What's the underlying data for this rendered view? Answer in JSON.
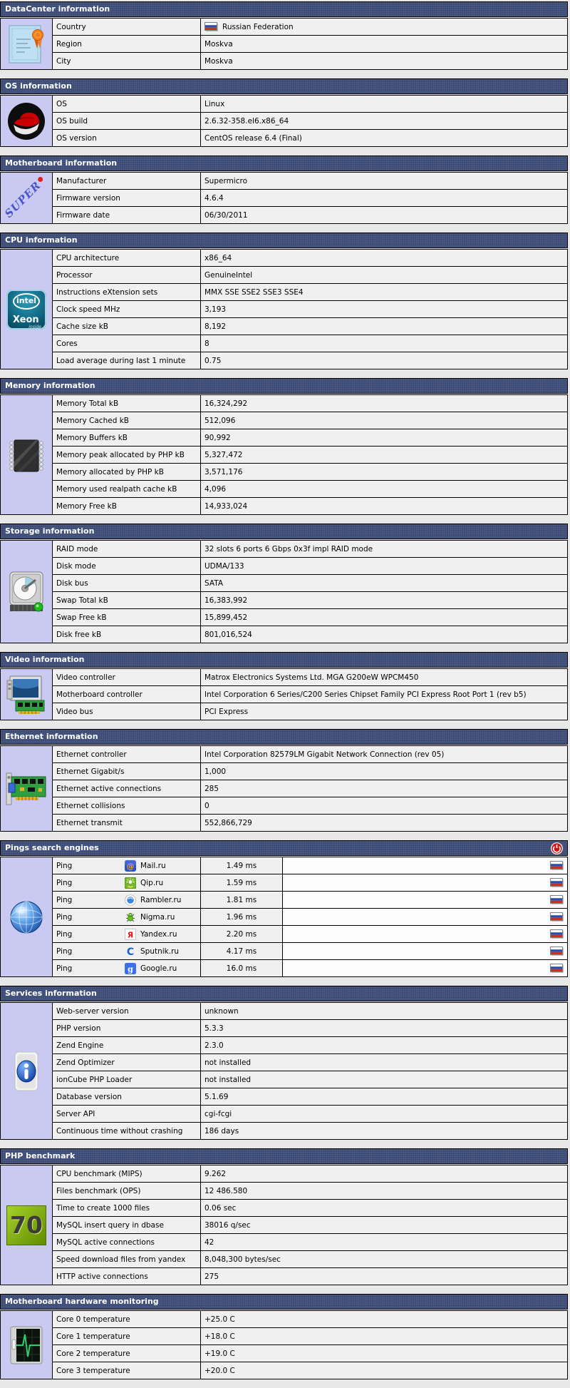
{
  "colors": {
    "header_bg": "#2d4b78",
    "header_text": "#ffffff",
    "icon_cell_bg": "#c9c9f1",
    "row_bg": "#f0f0f0",
    "page_bg": "#e8e8e8",
    "border": "#000000",
    "flag_white": "#ffffff",
    "flag_blue": "#2a4fa8",
    "flag_red": "#d52b1e"
  },
  "sections": [
    {
      "title": "DataCenter information",
      "icon": "certificate-icon",
      "type": "info",
      "rows": [
        {
          "label": "Country",
          "value": "Russian Federation",
          "value_flag": "russia-flag"
        },
        {
          "label": "Region",
          "value": "Moskva"
        },
        {
          "label": "City",
          "value": "Moskva"
        }
      ]
    },
    {
      "title": "OS information",
      "icon": "redhat-icon",
      "type": "info",
      "rows": [
        {
          "label": "OS",
          "value": "Linux"
        },
        {
          "label": "OS build",
          "value": "2.6.32-358.el6.x86_64"
        },
        {
          "label": "OS version",
          "value": "CentOS release 6.4 (Final)"
        }
      ]
    },
    {
      "title": "Motherboard information",
      "icon": "supermicro-icon",
      "type": "info",
      "rows": [
        {
          "label": "Manufacturer",
          "value": "Supermicro"
        },
        {
          "label": "Firmware version",
          "value": "4.6.4"
        },
        {
          "label": "Firmware date",
          "value": "06/30/2011"
        }
      ]
    },
    {
      "title": "CPU information",
      "icon": "intel-xeon-icon",
      "type": "info",
      "rows": [
        {
          "label": "CPU architecture",
          "value": "x86_64"
        },
        {
          "label": "Processor",
          "value": "GenuineIntel"
        },
        {
          "label": "Instructions eXtension sets",
          "value": "MMX SSE SSE2 SSE3 SSE4"
        },
        {
          "label": "Clock speed MHz",
          "value": "3,193"
        },
        {
          "label": "Cache size kB",
          "value": "8,192"
        },
        {
          "label": "Cores",
          "value": "8"
        },
        {
          "label": "Load average during last 1 minute",
          "value": "0.75"
        }
      ]
    },
    {
      "title": "Memory information",
      "icon": "ram-chip-icon",
      "type": "info",
      "rows": [
        {
          "label": "Memory Total kB",
          "value": "16,324,292"
        },
        {
          "label": "Memory Cached kB",
          "value": "512,096"
        },
        {
          "label": "Memory Buffers kB",
          "value": "90,992"
        },
        {
          "label": "Memory peak allocated by PHP kB",
          "value": "5,327,472"
        },
        {
          "label": "Memory allocated by PHP kB",
          "value": "3,571,176"
        },
        {
          "label": "Memory used realpath cache kB",
          "value": "4,096"
        },
        {
          "label": "Memory Free kB",
          "value": "14,933,024"
        }
      ]
    },
    {
      "title": "Storage information",
      "icon": "hdd-icon",
      "type": "info",
      "rows": [
        {
          "label": "RAID mode",
          "value": "32 slots 6 ports 6 Gbps 0x3f impl RAID mode"
        },
        {
          "label": "Disk mode",
          "value": "UDMA/133"
        },
        {
          "label": "Disk bus",
          "value": "SATA"
        },
        {
          "label": "Swap Total kB",
          "value": "16,383,992"
        },
        {
          "label": "Swap Free kB",
          "value": "15,899,452"
        },
        {
          "label": "Disk free kB",
          "value": "801,016,524"
        }
      ]
    },
    {
      "title": "Video information",
      "icon": "video-card-icon",
      "type": "info",
      "rows": [
        {
          "label": "Video controller",
          "value": "Matrox Electronics Systems Ltd. MGA G200eW WPCM450"
        },
        {
          "label": "Motherboard controller",
          "value": "Intel Corporation 6 Series/C200 Series Chipset Family PCI Express Root Port 1 (rev b5)"
        },
        {
          "label": "Video bus",
          "value": "PCI Express"
        }
      ]
    },
    {
      "title": "Ethernet information",
      "icon": "ethernet-card-icon",
      "type": "info",
      "rows": [
        {
          "label": "Ethernet controller",
          "value": "Intel Corporation 82579LM Gigabit Network Connection (rev 05)"
        },
        {
          "label": "Ethernet Gigabit/s",
          "value": "1,000"
        },
        {
          "label": "Ethernet active connections",
          "value": "285"
        },
        {
          "label": "Ethernet collisions",
          "value": "0"
        },
        {
          "label": "Ethernet transmit",
          "value": "552,866,729"
        }
      ]
    },
    {
      "title": "Pings search engines",
      "icon": "globe-icon",
      "header_icon": "power-icon",
      "type": "pings",
      "rows": [
        {
          "label": "Ping",
          "site": "Mail.ru",
          "site_icon": "mailru-icon",
          "value": "1.49 ms",
          "flag": "russia-flag"
        },
        {
          "label": "Ping",
          "site": "Qip.ru",
          "site_icon": "qip-icon",
          "value": "1.59 ms",
          "flag": "russia-flag"
        },
        {
          "label": "Ping",
          "site": "Rambler.ru",
          "site_icon": "rambler-icon",
          "value": "1.81 ms",
          "flag": "russia-flag"
        },
        {
          "label": "Ping",
          "site": "Nigma.ru",
          "site_icon": "nigma-icon",
          "value": "1.96 ms",
          "flag": "russia-flag"
        },
        {
          "label": "Ping",
          "site": "Yandex.ru",
          "site_icon": "yandex-icon",
          "value": "2.20 ms",
          "flag": "russia-flag"
        },
        {
          "label": "Ping",
          "site": "Sputnik.ru",
          "site_icon": "sputnik-icon",
          "value": "4.17 ms",
          "flag": "russia-flag"
        },
        {
          "label": "Ping",
          "site": "Google.ru",
          "site_icon": "google-icon",
          "value": "16.0 ms",
          "flag": "russia-flag"
        }
      ]
    },
    {
      "title": "Services information",
      "icon": "info-icon",
      "type": "info",
      "rows": [
        {
          "label": "Web-server version",
          "value": "unknown"
        },
        {
          "label": "PHP version",
          "value": "5.3.3"
        },
        {
          "label": "Zend Engine",
          "value": "2.3.0"
        },
        {
          "label": "Zend Optimizer",
          "value": "not installed"
        },
        {
          "label": "ionCube PHP Loader",
          "value": "not installed"
        },
        {
          "label": "Database version",
          "value": "5.1.69"
        },
        {
          "label": "Server API",
          "value": "cgi-fcgi"
        },
        {
          "label": "Continuous time without crashing",
          "value": "186 days"
        }
      ]
    },
    {
      "title": "PHP benchmark",
      "icon": "benchmark-70-icon",
      "type": "info",
      "rows": [
        {
          "label": "CPU benchmark (MIPS)",
          "value": "9.262"
        },
        {
          "label": "Files benchmark (OPS)",
          "value": "12 486.580"
        },
        {
          "label": "Time to create 1000 files",
          "value": "0.06 sec"
        },
        {
          "label": "MySQL insert query in dbase",
          "value": "38016 q/sec"
        },
        {
          "label": "MySQL active connections",
          "value": "42"
        },
        {
          "label": "Speed download files from yandex",
          "value": "8,048,300 bytes/sec"
        },
        {
          "label": "HTTP active connections",
          "value": "275"
        }
      ]
    },
    {
      "title": "Motherboard hardware monitoring",
      "icon": "monitoring-icon",
      "type": "info",
      "rows": [
        {
          "label": "Core 0 temperature",
          "value": "+25.0 C"
        },
        {
          "label": "Core 1 temperature",
          "value": "+18.0 C"
        },
        {
          "label": "Core 2 temperature",
          "value": "+19.0 C"
        },
        {
          "label": "Core 3 temperature",
          "value": "+20.0 C"
        }
      ]
    }
  ]
}
